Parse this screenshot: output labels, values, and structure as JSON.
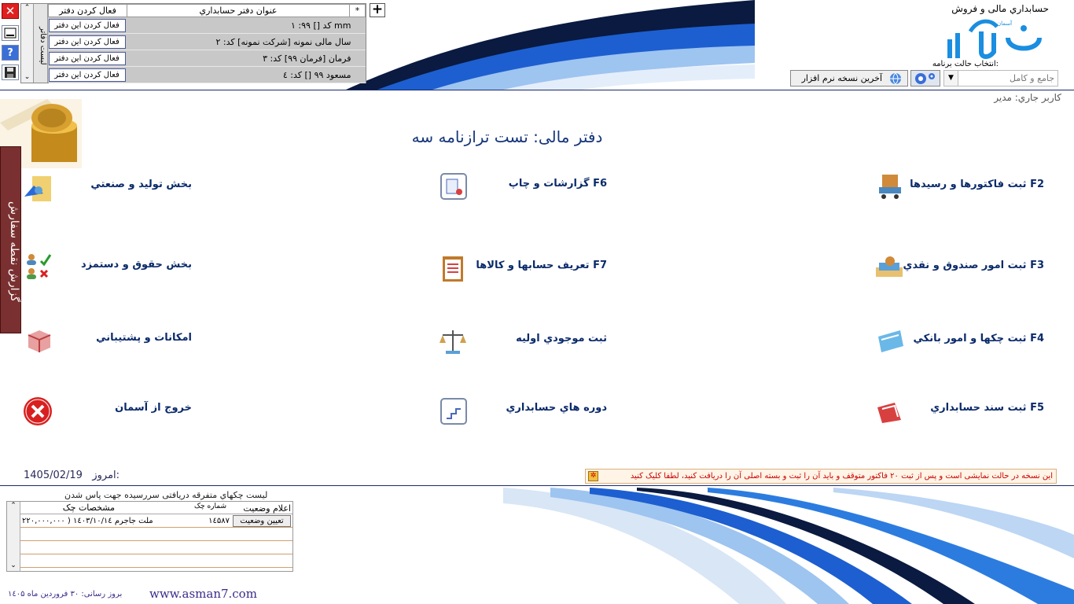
{
  "header": {
    "brand_title": "حسابداري مالی و فروش",
    "logo_text": "آسمان",
    "mode_label": "انتخاب حالت برنامه:",
    "mode_value": "جامع و کامل",
    "latest_version_label": "آخرین نسخه نرم افزار",
    "current_user": "کاربر جاري: مدير"
  },
  "toolbar": {
    "close_icon": "close-icon",
    "minimize_icon": "minimize-icon",
    "help_label": "?",
    "save_icon": "save-icon",
    "add_label": "+"
  },
  "ledger": {
    "side_tab": "لیست دفاتر",
    "col_star": "*",
    "col_title": "عنوان دفتر حسابداري",
    "col_action": "فعال کردن دفتر",
    "rows": [
      {
        "title": "۱ :کد  []  ۹۹ mm",
        "action": "فعال کردن اين دفتر"
      },
      {
        "title": "سال مالی نمونه [شرکت نمونه]  کد: ۲",
        "action": "فعال کردن اين دفتر"
      },
      {
        "title": "فرمان [فرمان ۹۹]  کد: ۳",
        "action": "فعال کردن اين دفتر"
      },
      {
        "title": "مسعود ۹۹ []  کد: ٤",
        "action": "فعال کردن اين دفتر"
      }
    ]
  },
  "side_report_tab": "گزارش نقطه سفارش",
  "financial_title": "دفتر مالی: تست ترازنامه سه",
  "menu": {
    "invoices": "ثبت فاکتورها و رسيدها F2",
    "reports": "گزارشات و چاپ  F6",
    "production": "بخش توليد و صنعتي",
    "cash": "ثبت امور صندوق و نقدي  F3",
    "accounts": "تعريف حسابها و کالاها  F7",
    "payroll": "بخش حقوق و دستمزد",
    "banking": "ثبت چکها و امور بانکي F4",
    "inventory": "ثبت موجودي اوليه",
    "backup": "امکانات و پشتيباني",
    "voucher": "ثبت سند حسابداري  F5",
    "periods": "دوره هاي حسابداري",
    "exit": "خروج از آسمان"
  },
  "footer": {
    "today_label": "امروز:",
    "today_date": "1405/02/19",
    "demo_notice": "اين نسخه در حالت نمايشی است و پس از ثبت ۲۰ فاکتور متوقف و بايد آن را ثبت و بسته اصلی آن را دريافت کنيد، لطفا کليک کنيد",
    "cheque_title": "ليست چکهاي متفرقه دريافتی سررسيده جهت پاس شدن",
    "cheque_cols": {
      "state": "اعلام وضعيت",
      "number": "شماره چک",
      "details": "مشخصات چک"
    },
    "cheque_rows": [
      {
        "state_btn": "تعيين وضعيت",
        "number": "۱٤۵۸۷",
        "details": "ملت جاجرم ۱٤۰۳/۱۰/۱٤  ( ۲۲۰,۰۰۰,۰۰۰"
      }
    ],
    "website": "www.asman7.com",
    "update_note": "بروز رسانی: ۳۰ فروردين ماه ۱٤۰۵"
  },
  "colors": {
    "accent": "#15357a",
    "brand_blue": "#1a8ee0",
    "side_tab": "#7a3030",
    "demo_red": "#cc0000"
  }
}
